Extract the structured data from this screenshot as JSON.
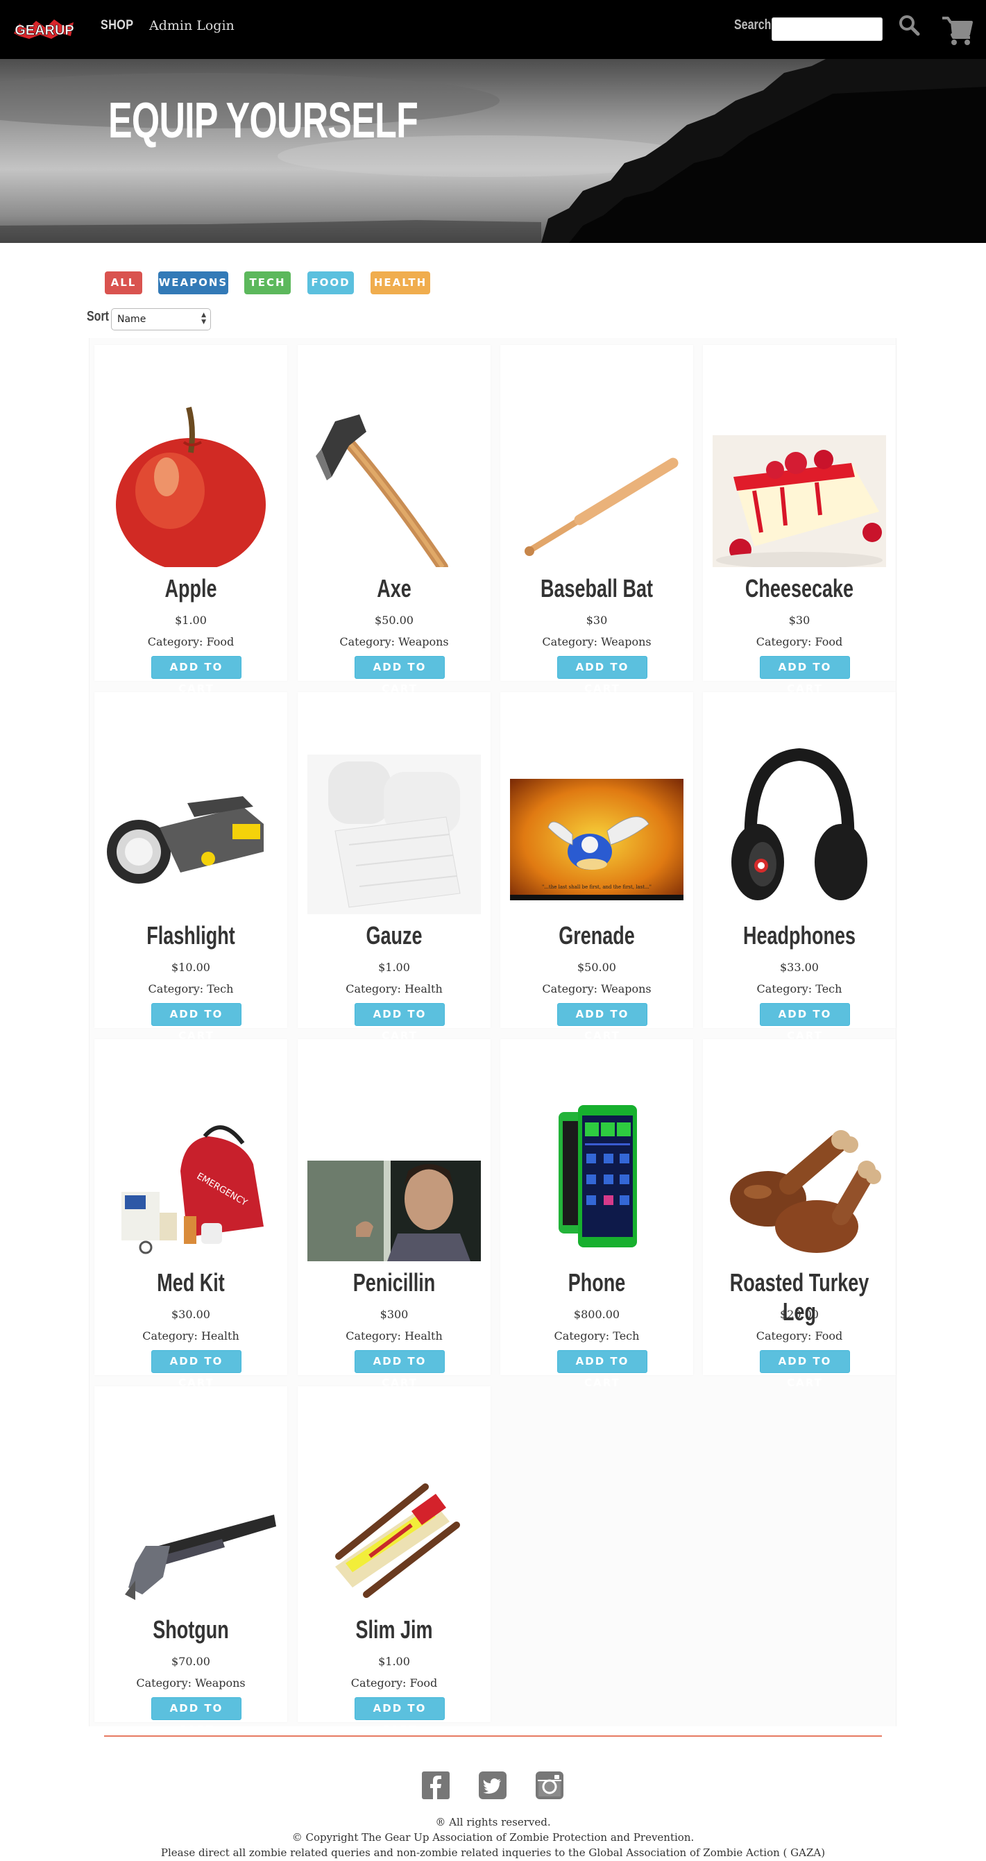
{
  "nav": {
    "logo_text": "GEARUP",
    "shop_label": "SHOP",
    "admin_label": "Admin Login",
    "search_label": "Search",
    "search_value": "",
    "search_icon": "search-icon",
    "cart_icon": "cart-icon"
  },
  "hero": {
    "title": "EQUIP YOURSELF"
  },
  "filters": [
    {
      "label": "ALL",
      "color": "#d9534f"
    },
    {
      "label": "WEAPONS",
      "color": "#337ab7"
    },
    {
      "label": "TECH",
      "color": "#5cb85c"
    },
    {
      "label": "FOOD",
      "color": "#5bc0de"
    },
    {
      "label": "HEALTH",
      "color": "#f0ad4e"
    }
  ],
  "sort": {
    "label": "Sort",
    "selected": "Name"
  },
  "products": [
    {
      "name": "Apple",
      "price": "$1.00",
      "category": "Category: Food",
      "button": "ADD TO CART",
      "icon": "apple-image"
    },
    {
      "name": "Axe",
      "price": "$50.00",
      "category": "Category: Weapons",
      "button": "ADD TO CART",
      "icon": "axe-image"
    },
    {
      "name": "Baseball Bat",
      "price": "$30",
      "category": "Category: Weapons",
      "button": "ADD TO CART",
      "icon": "baseball-bat-image"
    },
    {
      "name": "Cheesecake",
      "price": "$30",
      "category": "Category: Food",
      "button": "ADD TO CART",
      "icon": "cheesecake-image"
    },
    {
      "name": "Flashlight",
      "price": "$10.00",
      "category": "Category: Tech",
      "button": "ADD TO CART",
      "icon": "flashlight-image"
    },
    {
      "name": "Gauze",
      "price": "$1.00",
      "category": "Category: Health",
      "button": "ADD TO CART",
      "icon": "gauze-image"
    },
    {
      "name": "Grenade",
      "price": "$50.00",
      "category": "Category: Weapons",
      "button": "ADD TO CART",
      "icon": "grenade-image",
      "image_caption": "\"...the last shall be first, and the first, last...\""
    },
    {
      "name": "Headphones",
      "price": "$33.00",
      "category": "Category: Tech",
      "button": "ADD TO CART",
      "icon": "headphones-image"
    },
    {
      "name": "Med Kit",
      "price": "$30.00",
      "category": "Category: Health",
      "button": "ADD TO CART",
      "icon": "med-kit-image",
      "image_caption": "EMERGENCY"
    },
    {
      "name": "Penicillin",
      "price": "$300",
      "category": "Category: Health",
      "button": "ADD TO CART",
      "icon": "penicillin-image"
    },
    {
      "name": "Phone",
      "price": "$800.00",
      "category": "Category: Tech",
      "button": "ADD TO CART",
      "icon": "phone-image"
    },
    {
      "name": "Roasted Turkey Leg",
      "price": "$20.00",
      "category": "Category: Food",
      "button": "ADD TO CART",
      "icon": "turkey-leg-image"
    },
    {
      "name": "Shotgun",
      "price": "$70.00",
      "category": "Category: Weapons",
      "button": "ADD TO CART",
      "icon": "shotgun-image"
    },
    {
      "name": "Slim Jim",
      "price": "$1.00",
      "category": "Category: Food",
      "button": "ADD TO CART",
      "icon": "slim-jim-image"
    }
  ],
  "footer": {
    "social": [
      "facebook-icon",
      "twitter-icon",
      "instagram-icon"
    ],
    "rights": "® All rights reserved.",
    "copyright": "© Copyright The Gear Up Association of Zombie Protection and Prevention.",
    "contact": "Please direct all zombie related queries and non-zombie related inqueries to the Global Association of Zombie Action ( GAZA)"
  }
}
